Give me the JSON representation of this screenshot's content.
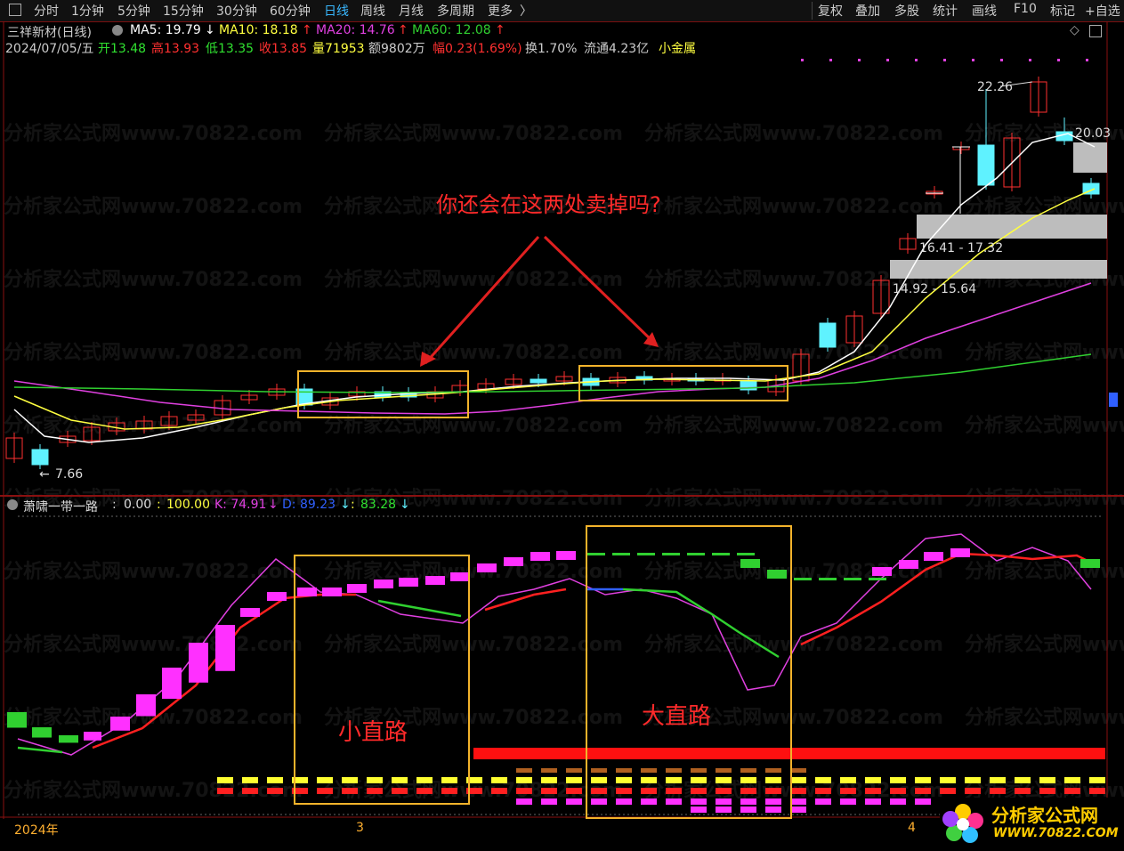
{
  "toolbar": {
    "left_tabs": [
      "分时",
      "1分钟",
      "5分钟",
      "15分钟",
      "30分钟",
      "60分钟",
      "日线",
      "周线",
      "月线",
      "多周期",
      "更多"
    ],
    "active_tab": "日线",
    "right_tabs": [
      "复权",
      "叠加",
      "多股",
      "统计",
      "画线",
      "F10",
      "标记",
      "+自选"
    ]
  },
  "stock": {
    "title": "三祥新材(日线)",
    "ma5": "MA5: 19.79",
    "ma10": "MA10: 18.18",
    "ma20": "MA20: 14.76",
    "ma60": "MA60: 12.08",
    "date": "2024/07/05/五",
    "open": "开13.48",
    "high": "高13.93",
    "low": "低13.35",
    "close": "收13.85",
    "volume": "量71953",
    "amount": "额9802万",
    "change": "幅0.23(1.69%)",
    "turnover": "换1.70%",
    "float_cap": "流通4.23亿",
    "sector": "小金属"
  },
  "price_labels": {
    "high_mark": "22.26",
    "right_mark": "20.03",
    "zone1": "16.41 - 17.32",
    "zone2": "14.92 - 15.64",
    "low_mark": "7.66"
  },
  "annotations": {
    "question": "你还会在这两处卖掉吗?",
    "small_road": "小直路",
    "big_road": "大直路"
  },
  "indicator": {
    "name": "萧啸一带一路",
    "v1": "0.00",
    "v2": "100.00",
    "k": "K: 74.91",
    "d": "D: 89.23",
    "j": "83.28"
  },
  "axis": {
    "year": "2024年",
    "m3": "3",
    "m4": "4"
  },
  "watermark": {
    "text": "分析家公式网www.70822.com",
    "logo_cn": "分析家公式网",
    "logo_url": "WWW.70822.COM"
  },
  "colors": {
    "up": "#ff3030",
    "down": "#5ff2ff",
    "ma5": "#ffffff",
    "ma10": "#ffff40",
    "ma20": "#e040e0",
    "ma60": "#30d030",
    "highlight": "#f3b32b",
    "arrow": "#e02020"
  }
}
